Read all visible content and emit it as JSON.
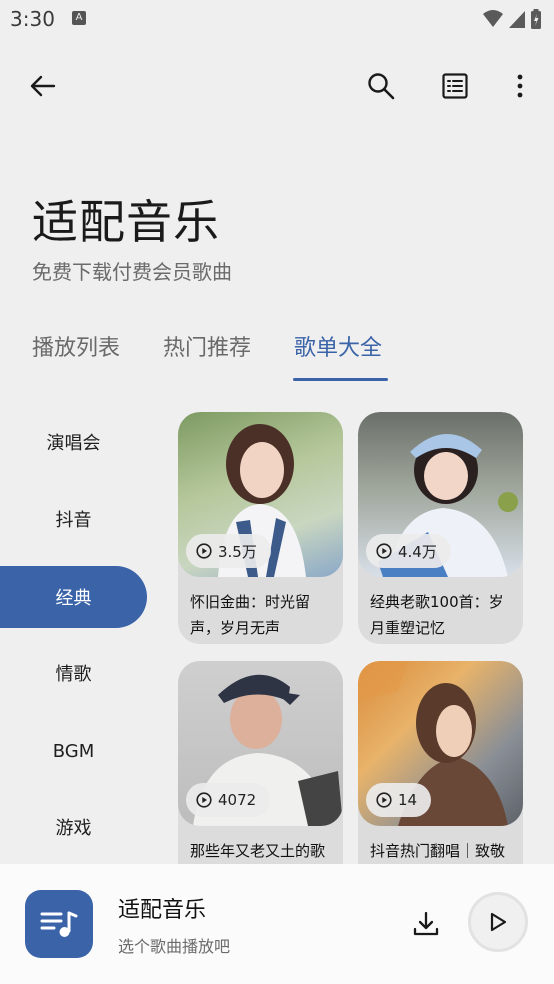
{
  "status_bar": {
    "time": "3:30",
    "a_badge": "A"
  },
  "app_bar": {
    "back_icon": "arrow-left-icon",
    "search_icon": "search-icon",
    "list_icon": "list-view-icon",
    "more_icon": "more-vert-icon"
  },
  "header": {
    "title": "适配音乐",
    "subtitle": "免费下载付费会员歌曲"
  },
  "tabs": [
    {
      "label": "播放列表"
    },
    {
      "label": "热门推荐"
    },
    {
      "label": "歌单大全",
      "active": true
    }
  ],
  "sidebar": {
    "items": [
      {
        "label": "演唱会"
      },
      {
        "label": "抖音"
      },
      {
        "label": "经典",
        "active": true
      },
      {
        "label": "情歌"
      },
      {
        "label": "BGM"
      },
      {
        "label": "游戏"
      }
    ]
  },
  "playlists": [
    {
      "play_count": "3.5万",
      "title": "怀旧金曲：时光留声，岁月无声"
    },
    {
      "play_count": "4.4万",
      "title": "经典老歌100首：岁月重塑记忆"
    },
    {
      "play_count": "4072",
      "title": "那些年又老又土的歌"
    },
    {
      "play_count": "14",
      "title": "抖音热门翻唱｜致敬"
    }
  ],
  "mini_player": {
    "title": "适配音乐",
    "subtitle": "选个歌曲播放吧",
    "download_icon": "download-icon",
    "play_icon": "play-icon"
  },
  "colors": {
    "accent": "#3a63a8",
    "background": "#efefef",
    "card": "#dcdcdc"
  }
}
